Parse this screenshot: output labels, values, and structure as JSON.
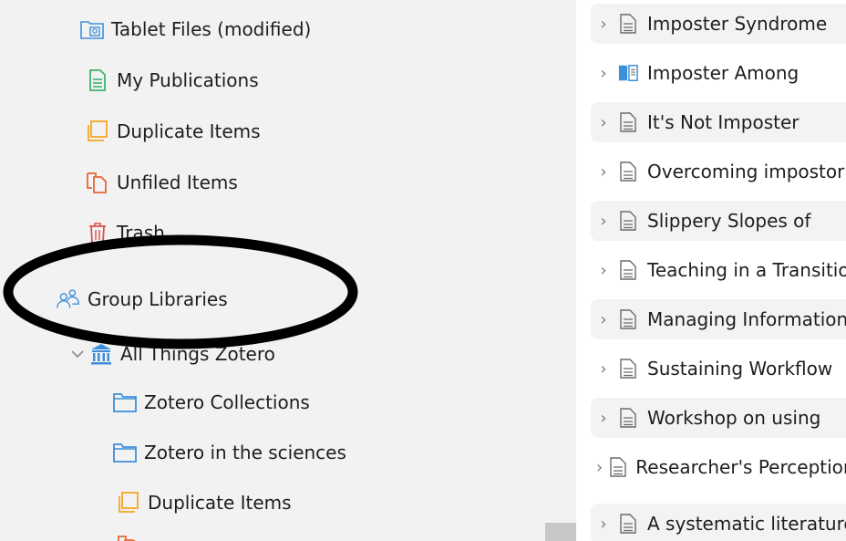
{
  "collections": {
    "tablet_files": "Tablet Files (modified)",
    "my_publications": "My Publications",
    "duplicate_items": "Duplicate Items",
    "unfiled_items": "Unfiled Items",
    "trash": "Trash",
    "group_libraries": "Group Libraries",
    "group_name": "All Things Zotero",
    "group_children": {
      "zotero_collections": "Zotero Collections",
      "zotero_in_sciences": "Zotero in the sciences",
      "duplicate_items": "Duplicate Items"
    }
  },
  "items": [
    {
      "title": "Imposter Syndrome",
      "icon": "document-icon"
    },
    {
      "title": "Imposter Among",
      "icon": "book-icon"
    },
    {
      "title": "It's Not Imposter",
      "icon": "document-icon"
    },
    {
      "title": "Overcoming impostor",
      "icon": "document-icon"
    },
    {
      "title": "Slippery Slopes of",
      "icon": "document-icon"
    },
    {
      "title": "Teaching in a Transition",
      "icon": "document-icon"
    },
    {
      "title": "Managing Information",
      "icon": "document-icon"
    },
    {
      "title": "Sustaining Workflow",
      "icon": "document-icon"
    },
    {
      "title": "Workshop on using",
      "icon": "document-icon"
    },
    {
      "title": "Researcher's Perceptions",
      "icon": "document-icon"
    },
    {
      "title": "A systematic literature",
      "icon": "document-icon"
    }
  ],
  "colors": {
    "folder_blue": "#3d8fd9",
    "publications_green": "#3cb371",
    "duplicates_orange": "#f5a623",
    "unfiled_red": "#e5673a",
    "trash_red": "#d9534f",
    "group_blue": "#3d8fd9",
    "annotation_black": "#000000"
  }
}
